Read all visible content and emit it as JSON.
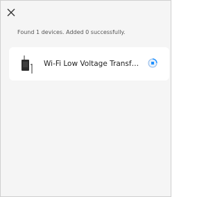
{
  "header": {
    "close_icon": "close-icon"
  },
  "status": {
    "message": "Found 1 devices. Added 0 successfully."
  },
  "devices": [
    {
      "name": "Wi-Fi Low Voltage Transformer",
      "icon": "transformer-device-icon",
      "state_icon": "adding-progress-icon"
    }
  ],
  "colors": {
    "accent": "#1e90ff",
    "background": "#f5f5f5",
    "card": "#ffffff"
  }
}
